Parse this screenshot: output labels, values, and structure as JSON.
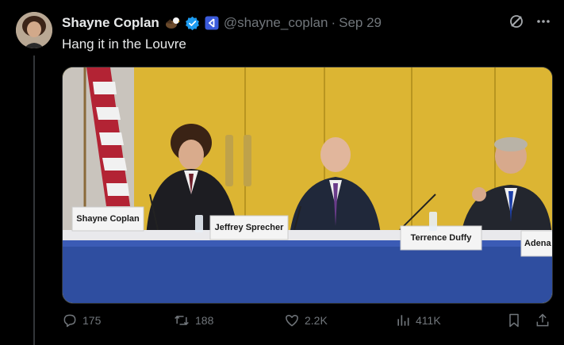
{
  "author": {
    "name": "Shayne Coplan",
    "handle": "@shayne_coplan",
    "date": "Sep 29"
  },
  "icons": {
    "eagle": "eagle-emoji",
    "verified": "verified-badge-icon",
    "affiliate": "affiliate-badge-icon",
    "grok": "grok-icon",
    "more": "more-icon"
  },
  "tweet": {
    "text": "Hang it in the Louvre"
  },
  "media": {
    "nameplates": [
      "Shayne Coplan",
      "Jeffrey Sprecher",
      "Terrence Duffy",
      "Adena"
    ]
  },
  "actions": {
    "replies": "175",
    "retweets": "188",
    "likes": "2.2K",
    "views": "411K"
  },
  "colors": {
    "background": "#000000",
    "text": "#e7e9ea",
    "muted": "#71767b",
    "verified": "#1d9bf0",
    "affiliate": "#3b5bdb"
  }
}
